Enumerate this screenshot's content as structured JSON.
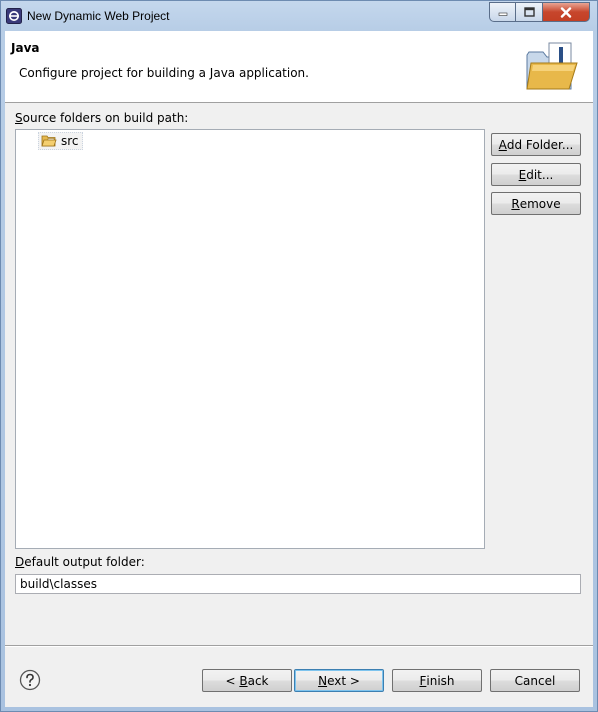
{
  "window": {
    "title": "New Dynamic Web Project"
  },
  "header": {
    "title": "Java",
    "description": "Configure project for building a Java application."
  },
  "source_folders": {
    "label_prefix": "",
    "label_mnemonic": "S",
    "label_rest": "ource folders on build path:",
    "items": [
      {
        "label": "src",
        "icon": "source-folder-icon"
      }
    ]
  },
  "side_buttons": {
    "add_folder": {
      "mnemonic": "A",
      "rest": "dd Folder..."
    },
    "edit": {
      "mnemonic": "E",
      "rest": "dit..."
    },
    "remove": {
      "mnemonic": "R",
      "rest": "emove"
    }
  },
  "output": {
    "label_mnemonic": "D",
    "label_rest": "efault output folder:",
    "value": "build\\classes"
  },
  "footer": {
    "back": {
      "pre": "< ",
      "mnemonic": "B",
      "rest": "ack"
    },
    "next": {
      "mnemonic": "N",
      "rest": "ext >"
    },
    "finish": {
      "mnemonic": "F",
      "rest": "inish"
    },
    "cancel": "Cancel"
  },
  "colors": {
    "accent": "#3c7fb1",
    "close": "#c7462c"
  }
}
